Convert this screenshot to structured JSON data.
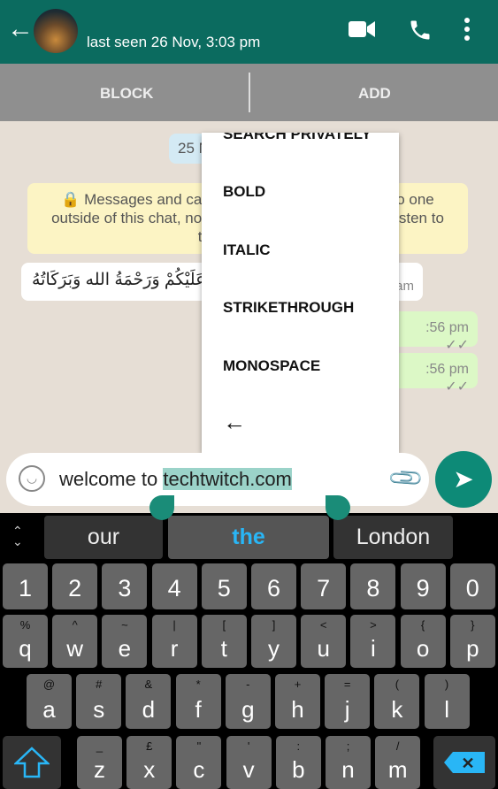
{
  "header": {
    "last_seen": "last seen 26 Nov, 3:03 pm",
    "colors": {
      "header": "#0b6b5f",
      "accent": "#0d8a77"
    }
  },
  "actionbar": {
    "block": "BLOCK",
    "add": "ADD"
  },
  "chat": {
    "date": "25 N",
    "system": "Messages and calls are end-to-end encrypted. No one outside of this chat, not even WhatsApp, can read or listen to them.",
    "system_visible_1": "Messages and call",
    "system_visible_1r": "No one",
    "system_visible_2": "outside of this chat, not",
    "system_visible_2r": "r listen to",
    "system_visible_3": "them.",
    "incoming_text": "عَلَيْكُمْ وَرَحْمَةُ الله وَبَرَكَاتُهُ",
    "incoming_time": "am",
    "out1_time": ":56 pm ✓✓",
    "out2_time": ":56 pm ✓✓"
  },
  "menu": {
    "items": [
      "SEARCH PRIVATELY",
      "BOLD",
      "ITALIC",
      "STRIKETHROUGH",
      "MONOSPACE"
    ]
  },
  "input": {
    "prefix": "welcome to ",
    "selected": "techtwitch.com"
  },
  "keyboard": {
    "suggestions": [
      "our",
      "the",
      "London"
    ],
    "numbers": [
      "1",
      "2",
      "3",
      "4",
      "5",
      "6",
      "7",
      "8",
      "9",
      "0"
    ],
    "row1": [
      [
        "%",
        "q"
      ],
      [
        "^",
        "w"
      ],
      [
        "~",
        "e"
      ],
      [
        "|",
        "r"
      ],
      [
        "[",
        "t"
      ],
      [
        "]",
        "y"
      ],
      [
        "<",
        "u"
      ],
      [
        ">",
        "i"
      ],
      [
        "{",
        "o"
      ],
      [
        "}",
        "p"
      ]
    ],
    "row2": [
      [
        "@",
        "a"
      ],
      [
        "#",
        "s"
      ],
      [
        "&",
        "d"
      ],
      [
        "*",
        "f"
      ],
      [
        "-",
        "g"
      ],
      [
        "+",
        "h"
      ],
      [
        "=",
        "j"
      ],
      [
        "(",
        "k"
      ],
      [
        ")",
        "l"
      ]
    ],
    "row3": [
      [
        "_",
        "z"
      ],
      [
        "£",
        "x"
      ],
      [
        "\"",
        "c"
      ],
      [
        "'",
        "v"
      ],
      [
        ":",
        "b"
      ],
      [
        ";",
        "n"
      ],
      [
        "/",
        "m"
      ]
    ]
  }
}
